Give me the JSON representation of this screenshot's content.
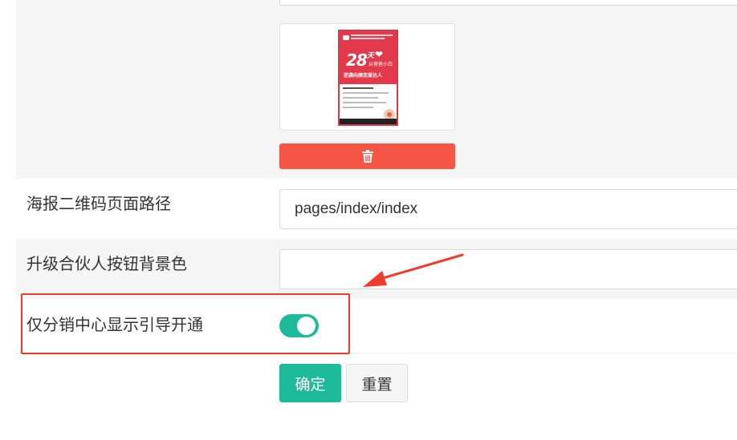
{
  "image_upload": {
    "poster": {
      "headline_number": "28",
      "headline_suffix": "天",
      "line_1": "从爸爸小白",
      "line_2": "逆袭向撩恋爱达人"
    },
    "delete_icon": "trash-icon"
  },
  "fields": {
    "poster_qr_path": {
      "label": "海报二维码页面路径",
      "value": "pages/index/index"
    },
    "upgrade_button_bg": {
      "label": "升级合伙人按钮背景色",
      "value": ""
    },
    "only_distribution_guide": {
      "label": "仅分销中心显示引导开通",
      "enabled": true
    }
  },
  "actions": {
    "confirm_label": "确定",
    "reset_label": "重置"
  },
  "colors": {
    "accent": "#1dbb99",
    "danger": "#f55544",
    "annotation": "#ef3b2d"
  }
}
